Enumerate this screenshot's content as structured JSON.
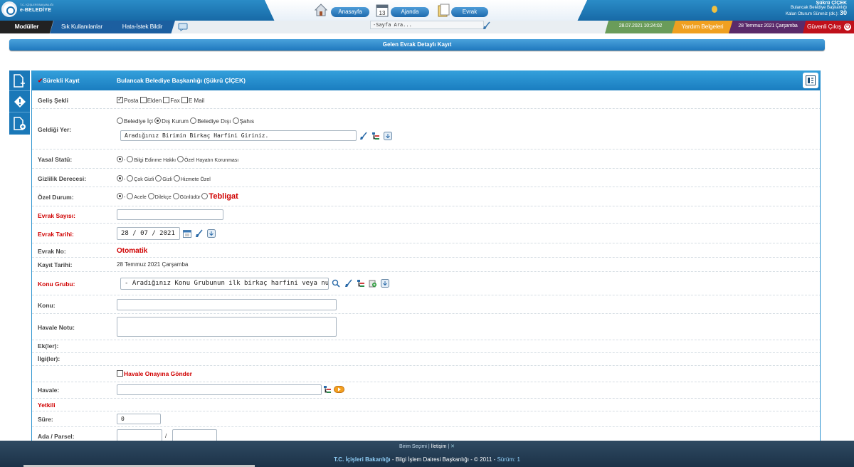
{
  "header": {
    "logo_small": "T.C. İÇİŞLERİ BAKANLIĞI",
    "logo_big": "e-BELEDİYE",
    "nav": [
      {
        "label": "Anasayfa"
      },
      {
        "label": "Ajanda"
      },
      {
        "label": "Evrak"
      }
    ],
    "calendar_day": "13",
    "user_name": "Şükrü ÇİÇEK",
    "user_org": "Bulancak Belediye Başkanlığı",
    "session_label": "Kalan Oturum Süreniz (dk.):",
    "session_value": "30"
  },
  "menubar": {
    "modules": "Modüller",
    "favorites": "Sık Kullanılanlar",
    "report_error": "Hata-İstek Bildir",
    "search_placeholder": "-Sayfa Ara...",
    "datetime": "28.07.2021 10:24:02",
    "help_docs": "Yardım Belgeleri",
    "date_long": "28 Temmuz 2021 Çarşamba",
    "logout": "Güvenli Çıkış"
  },
  "page_title": "Gelen Evrak Detaylı Kayıt",
  "form": {
    "continuous_label": "Sürekli Kayıt",
    "institution": "Bulancak Belediye Başkanlığı (Şükrü ÇİÇEK)",
    "arrival": {
      "label": "Geliş Şekli",
      "options": [
        "Posta",
        "Elden",
        "Fax",
        "E Mail"
      ]
    },
    "source": {
      "label": "Geldiği Yer:",
      "options": [
        "Belediye İçi",
        "Dış Kurum",
        "Belediye Dışı",
        "Şahıs"
      ],
      "placeholder": "Aradığınız Birimin Birkaç Harfini Giriniz."
    },
    "legal_status": {
      "label": "Yasal Statü:",
      "options": [
        "-",
        "Bilgi Edinme Hakkı",
        "Özel Hayatın Korunması"
      ]
    },
    "privacy": {
      "label": "Gizlilik Derecesi:",
      "options": [
        "-",
        "Çok Gizli",
        "Gizli",
        "Hizmete Özel"
      ]
    },
    "special": {
      "label": "Özel Durum:",
      "options": [
        "-",
        "Acele",
        "Dilekçe",
        "Günlüdür"
      ],
      "notification": "Tebligat"
    },
    "doc_number": {
      "label": "Evrak Sayısı:",
      "value": ""
    },
    "doc_date": {
      "label": "Evrak Tarihi:",
      "value": "28 / 07 / 2021"
    },
    "doc_no": {
      "label": "Evrak No:",
      "value": "Otomatik"
    },
    "record_date": {
      "label": "Kayıt Tarihi:",
      "value": "28 Temmuz 2021 Çarşamba"
    },
    "subject_group": {
      "label": "Konu Grubu:",
      "value": "- Aradığınız Konu Grubunun ilk birkaç harfini veya nu"
    },
    "subject": {
      "label": "Konu:",
      "value": ""
    },
    "referral_note": {
      "label": "Havale Notu:",
      "value": ""
    },
    "attachments": {
      "label": "Ek(ler):"
    },
    "related": {
      "label": "İlgi(ler):"
    },
    "send_approval": "Havale Onayına Gönder",
    "referral": {
      "label": "Havale:",
      "value": ""
    },
    "authority": {
      "label": "Yetkili"
    },
    "duration": {
      "label": "Süre:",
      "value": "0"
    },
    "parcel": {
      "label": "Ada / Parsel:",
      "separator": "/"
    }
  },
  "footer": {
    "unit_select": "Birim Seçimi",
    "contact": "İletişim",
    "ministry": "T.C. İçişleri Bakanlığı",
    "dept": " - Bilgi İşlem Dairesi Başkanlığı - © 2011",
    "version": "Sürüm: 1"
  },
  "colors": {
    "accent": "#1a7dc0",
    "required": "#d00000",
    "footer": "#24394f"
  }
}
